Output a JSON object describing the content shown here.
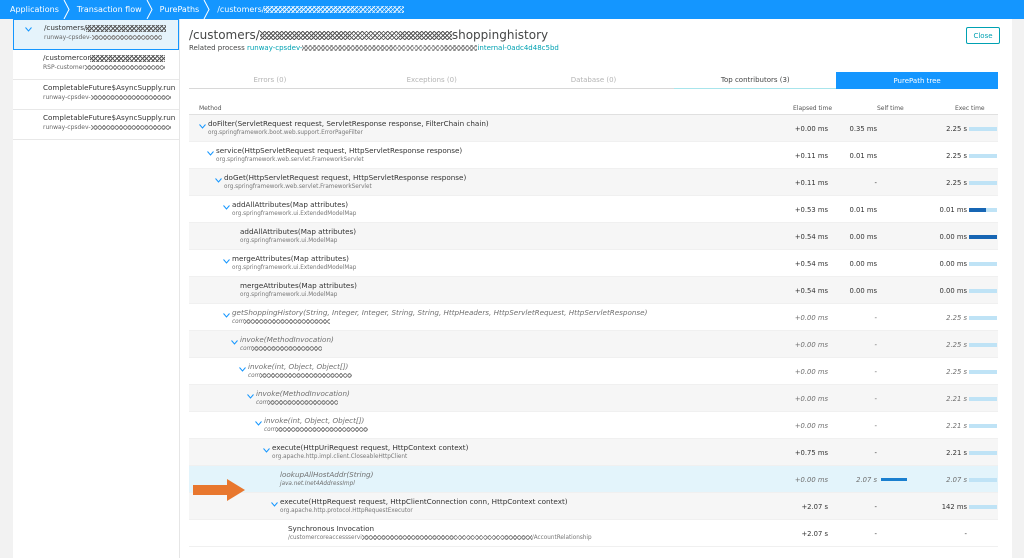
{
  "breadcrumb": {
    "items": [
      "Applications",
      "Transaction flow",
      "PurePaths"
    ],
    "last": "/customers/"
  },
  "sidebar": {
    "items": [
      {
        "title": "/customers/",
        "sub": "runway-cpsdev-",
        "selected": true
      },
      {
        "title": "/customercor",
        "sub": "RSP-customer",
        "selected": false
      },
      {
        "title": "CompletableFuture$AsyncSupply.run",
        "sub": "runway-cpsdev-",
        "selected": false
      },
      {
        "title": "CompletableFuture$AsyncSupply.run",
        "sub": "runway-cpsdev-",
        "selected": false
      }
    ]
  },
  "header": {
    "title_prefix": "/customers/",
    "title_suffix": "shoppinghistory",
    "related_label": "Related process",
    "related_link_prefix": "runway-cpsdev-",
    "related_link_suffix": "internal-0adc4d48c5bd",
    "close_label": "Close"
  },
  "tabs": [
    {
      "label": "Errors (0)",
      "state": "disabled"
    },
    {
      "label": "Exceptions (0)",
      "state": "disabled"
    },
    {
      "label": "Database (0)",
      "state": "disabled"
    },
    {
      "label": "Top contributors (3)",
      "state": "normal"
    },
    {
      "label": "PurePath tree",
      "state": "active"
    }
  ],
  "table": {
    "columns": {
      "method": "Method",
      "elapsed": "Elapsed time",
      "self": "Self time",
      "exec": "Exec time"
    },
    "rows": [
      {
        "depth": 0,
        "chevron": true,
        "name": "doFilter(ServletRequest request, ServletResponse response, FilterChain chain)",
        "cls": "org.springframework.boot.web.support.ErrorPageFilter",
        "elapsed": "+0.00 ms",
        "self": "0.35 ms",
        "self_frac": 0,
        "exec": "2.25 s",
        "exec_frac": 0,
        "italic": false
      },
      {
        "depth": 1,
        "chevron": true,
        "name": "service(HttpServletRequest request, HttpServletResponse response)",
        "cls": "org.springframework.web.servlet.FrameworkServlet",
        "elapsed": "+0.11 ms",
        "self": "0.01 ms",
        "self_frac": 0,
        "exec": "2.25 s",
        "exec_frac": 0,
        "italic": false
      },
      {
        "depth": 2,
        "chevron": true,
        "name": "doGet(HttpServletRequest request, HttpServletResponse response)",
        "cls": "org.springframework.web.servlet.FrameworkServlet",
        "elapsed": "+0.11 ms",
        "self": "-",
        "self_frac": 0,
        "exec": "2.25 s",
        "exec_frac": 0,
        "italic": false
      },
      {
        "depth": 3,
        "chevron": true,
        "name": "addAllAttributes(Map attributes)",
        "cls": "org.springframework.ui.ExtendedModelMap",
        "elapsed": "+0.53 ms",
        "self": "0.01 ms",
        "self_frac": 0,
        "exec": "0.01 ms",
        "exec_frac": 0.6,
        "italic": false
      },
      {
        "depth": 4,
        "chevron": false,
        "name": "addAllAttributes(Map attributes)",
        "cls": "org.springframework.ui.ModelMap",
        "elapsed": "+0.54 ms",
        "self": "0.00 ms",
        "self_frac": 0,
        "exec": "0.00 ms",
        "exec_frac": 1.0,
        "italic": false
      },
      {
        "depth": 3,
        "chevron": true,
        "name": "mergeAttributes(Map attributes)",
        "cls": "org.springframework.ui.ExtendedModelMap",
        "elapsed": "+0.54 ms",
        "self": "0.00 ms",
        "self_frac": 0,
        "exec": "0.00 ms",
        "exec_frac": 0,
        "italic": false
      },
      {
        "depth": 4,
        "chevron": false,
        "name": "mergeAttributes(Map attributes)",
        "cls": "org.springframework.ui.ModelMap",
        "elapsed": "+0.54 ms",
        "self": "0.00 ms",
        "self_frac": 0,
        "exec": "0.00 ms",
        "exec_frac": 0,
        "italic": false
      },
      {
        "depth": 3,
        "chevron": true,
        "name": "getShoppingHistory(String, Integer, Integer, String, String, HttpHeaders, HttpServletRequest, HttpServletResponse)",
        "cls": "com",
        "elapsed": "+0.00 ms",
        "self": "-",
        "self_frac": 0,
        "exec": "2.25 s",
        "exec_frac": 0,
        "italic": true
      },
      {
        "depth": 4,
        "chevron": true,
        "name": "invoke(MethodInvocation)",
        "cls": "com",
        "elapsed": "+0.00 ms",
        "self": "-",
        "self_frac": 0,
        "exec": "2.25 s",
        "exec_frac": 0,
        "italic": true
      },
      {
        "depth": 5,
        "chevron": true,
        "name": "invoke(int, Object, Object[])",
        "cls": "com",
        "elapsed": "+0.00 ms",
        "self": "-",
        "self_frac": 0,
        "exec": "2.25 s",
        "exec_frac": 0,
        "italic": true
      },
      {
        "depth": 6,
        "chevron": true,
        "name": "invoke(MethodInvocation)",
        "cls": "com",
        "elapsed": "+0.00 ms",
        "self": "-",
        "self_frac": 0,
        "exec": "2.21 s",
        "exec_frac": 0,
        "italic": true
      },
      {
        "depth": 7,
        "chevron": true,
        "name": "invoke(int, Object, Object[])",
        "cls": "com",
        "elapsed": "+0.00 ms",
        "self": "-",
        "self_frac": 0,
        "exec": "2.21 s",
        "exec_frac": 0,
        "italic": true
      },
      {
        "depth": 8,
        "chevron": true,
        "name": "execute(HttpUriRequest request, HttpContext context)",
        "cls": "org.apache.http.impl.client.CloseableHttpClient",
        "elapsed": "+0.75 ms",
        "self": "-",
        "self_frac": 0,
        "exec": "2.21 s",
        "exec_frac": 0,
        "italic": false
      },
      {
        "depth": 9,
        "chevron": false,
        "name": "lookupAllHostAddr(String)",
        "cls": "java.net.Inet4AddressImpl",
        "elapsed": "+0.00 ms",
        "self": "2.07 s",
        "self_frac": 1.0,
        "exec": "2.07 s",
        "exec_frac": 0,
        "italic": true,
        "highlight": true
      },
      {
        "depth": 9,
        "chevron": true,
        "name": "execute(HttpRequest request, HttpClientConnection conn, HttpContext context)",
        "cls": "org.apache.http.protocol.HttpRequestExecutor",
        "elapsed": "+2.07 s",
        "self": "-",
        "self_frac": 0,
        "exec": "142 ms",
        "exec_frac": 0,
        "italic": false
      },
      {
        "depth": 10,
        "chevron": false,
        "name": "Synchronous Invocation",
        "cls": "/customercoreaccessservi",
        "cls_suffix": "/AccountRelationship",
        "elapsed": "+2.07 s",
        "self": "-",
        "self_frac": 0,
        "exec": "-",
        "exec_frac": -1,
        "italic": false
      }
    ]
  },
  "colors": {
    "accent": "#1496ff",
    "teal": "#00a1b2",
    "bar_dark": "#1766b4",
    "bar_light": "#bfe3f6",
    "arrow": "#e8772e"
  }
}
